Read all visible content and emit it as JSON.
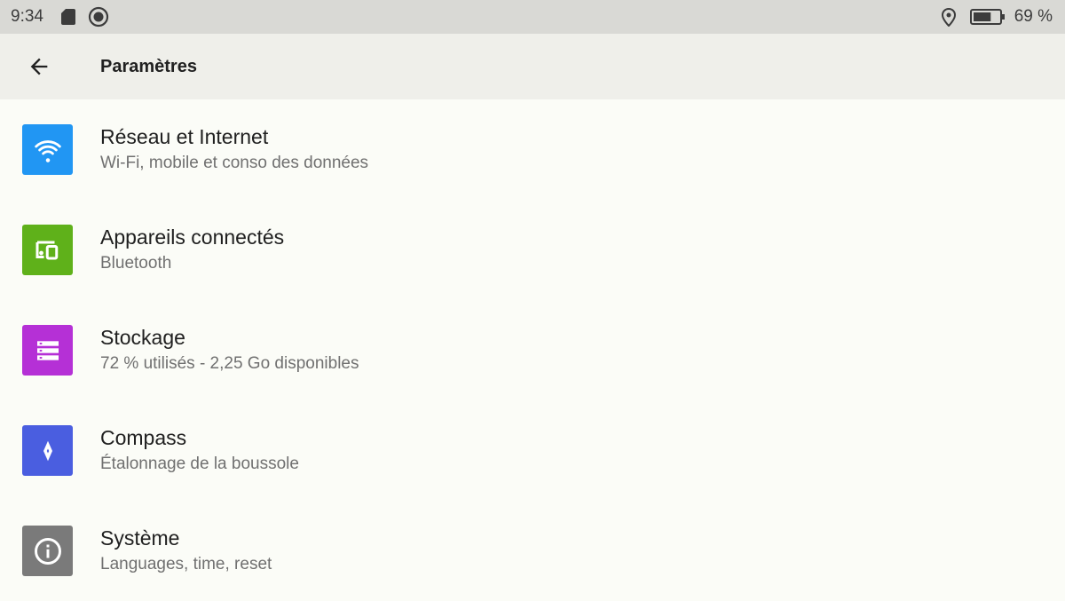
{
  "status_bar": {
    "time": "9:34",
    "battery_text": "69 %",
    "battery_level": 0.69,
    "icons": [
      "sd-card-icon",
      "screen-record-icon",
      "location-icon",
      "battery-icon"
    ]
  },
  "toolbar": {
    "title": "Paramètres",
    "back_icon": "arrow-back-icon"
  },
  "settings": [
    {
      "title": "Réseau et Internet",
      "subtitle": "Wi-Fi, mobile et conso des données",
      "icon": "wifi-icon",
      "color": "#2196f3"
    },
    {
      "title": "Appareils connectés",
      "subtitle": "Bluetooth",
      "icon": "devices-icon",
      "color": "#5fb11a"
    },
    {
      "title": "Stockage",
      "subtitle": "72 % utilisés - 2,25 Go disponibles",
      "icon": "storage-icon",
      "color": "#b530d6"
    },
    {
      "title": "Compass",
      "subtitle": "Étalonnage de la boussole",
      "icon": "compass-icon",
      "color": "#4a5ee0"
    },
    {
      "title": "Système",
      "subtitle": "Languages, time, reset",
      "icon": "info-icon",
      "color": "#7a7a7a"
    }
  ]
}
